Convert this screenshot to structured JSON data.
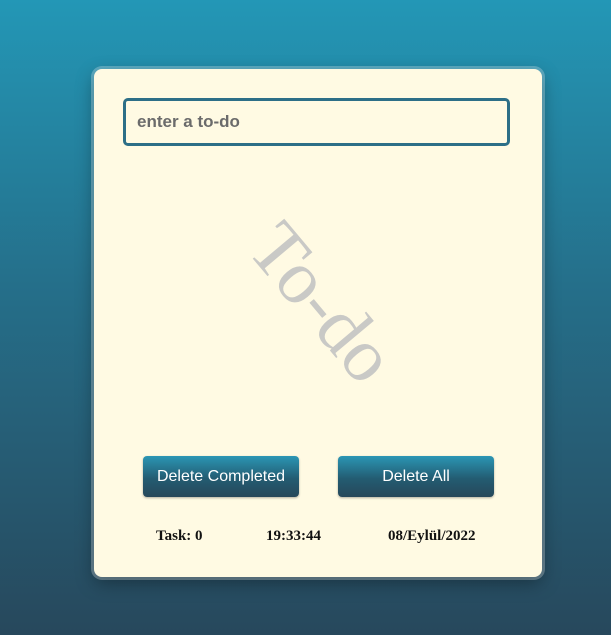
{
  "input": {
    "value": "",
    "placeholder": "enter a to-do"
  },
  "watermark": {
    "text": "To-do"
  },
  "buttons": {
    "delete_completed": "Delete Completed",
    "delete_all": "Delete All"
  },
  "footer": {
    "task_count": "Task: 0",
    "time": "19:33:44",
    "date": "08/Eylül/2022"
  },
  "colors": {
    "card_background": "#fffae3",
    "input_border": "#2d6f87",
    "button_gradient_top": "#2b96b4",
    "button_gradient_bottom": "#27485a",
    "watermark": "#c9c9c6"
  }
}
